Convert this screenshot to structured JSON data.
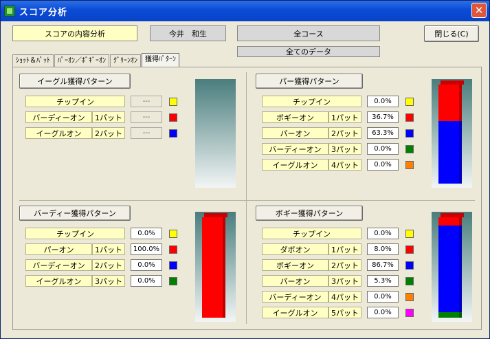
{
  "window": {
    "title": "スコア分析",
    "close": "✕"
  },
  "header": {
    "analysis_label": "スコアの内容分析",
    "player": "今井　和生",
    "course": "全コース",
    "data_scope": "全てのデータ",
    "close_button": "閉じる(C)"
  },
  "tabs": [
    "ｼｮｯﾄ＆ﾊﾟｯﾄ",
    "ﾊﾟｰｵﾝ／ﾎﾞｷﾞｰｵﾝ",
    "ｸﾞﾘｰﾝｵﾝ",
    "獲得ﾊﾟﾀｰﾝ"
  ],
  "colors": {
    "yellow": "#ffff00",
    "red": "#ff0000",
    "blue": "#0000ff",
    "green": "#008000",
    "orange": "#ff8000",
    "magenta": "#ff00ff"
  },
  "sections": {
    "eagle": {
      "title": "イーグル獲得パターン",
      "rows": [
        {
          "label": "チップイン",
          "putt": "",
          "value": "---",
          "color": "yellow"
        },
        {
          "label": "バーディーオン",
          "putt": "1パット",
          "value": "---",
          "color": "red"
        },
        {
          "label": "イーグルオン",
          "putt": "2パット",
          "value": "---",
          "color": "blue"
        }
      ]
    },
    "par": {
      "title": "パー獲得パターン",
      "rows": [
        {
          "label": "チップイン",
          "putt": "",
          "value": "0.0%",
          "color": "yellow"
        },
        {
          "label": "ボギーオン",
          "putt": "1パット",
          "value": "36.7%",
          "color": "red"
        },
        {
          "label": "パーオン",
          "putt": "2パット",
          "value": "63.3%",
          "color": "blue"
        },
        {
          "label": "バーディーオン",
          "putt": "3パット",
          "value": "0.0%",
          "color": "green"
        },
        {
          "label": "イーグルオン",
          "putt": "4パット",
          "value": "0.0%",
          "color": "orange"
        }
      ]
    },
    "birdie": {
      "title": "バーディー獲得パターン",
      "rows": [
        {
          "label": "チップイン",
          "putt": "",
          "value": "0.0%",
          "color": "yellow"
        },
        {
          "label": "パーオン",
          "putt": "1パット",
          "value": "100.0%",
          "color": "red"
        },
        {
          "label": "バーディーオン",
          "putt": "2パット",
          "value": "0.0%",
          "color": "blue"
        },
        {
          "label": "イーグルオン",
          "putt": "3パット",
          "value": "0.0%",
          "color": "green"
        }
      ]
    },
    "bogey": {
      "title": "ボギー獲得パターン",
      "rows": [
        {
          "label": "チップイン",
          "putt": "",
          "value": "0.0%",
          "color": "yellow"
        },
        {
          "label": "ダボオン",
          "putt": "1パット",
          "value": "8.0%",
          "color": "red"
        },
        {
          "label": "ボギーオン",
          "putt": "2パット",
          "value": "86.7%",
          "color": "blue"
        },
        {
          "label": "パーオン",
          "putt": "3パット",
          "value": "5.3%",
          "color": "green"
        },
        {
          "label": "バーディーオン",
          "putt": "4パット",
          "value": "0.0%",
          "color": "orange"
        },
        {
          "label": "イーグルオン",
          "putt": "5パット",
          "value": "0.0%",
          "color": "magenta"
        }
      ]
    }
  },
  "chart_data": [
    {
      "type": "bar",
      "stacked": true,
      "series": []
    },
    {
      "type": "bar",
      "stacked": true,
      "series": [
        {
          "name": "ボギーオン",
          "values": [
            36.7
          ],
          "color": "#ff0000"
        },
        {
          "name": "パーオン",
          "values": [
            63.3
          ],
          "color": "#0000ff"
        }
      ]
    },
    {
      "type": "bar",
      "stacked": true,
      "series": [
        {
          "name": "パーオン",
          "values": [
            100.0
          ],
          "color": "#ff0000"
        }
      ]
    },
    {
      "type": "bar",
      "stacked": true,
      "series": [
        {
          "name": "ダボオン",
          "values": [
            8.0
          ],
          "color": "#ff0000"
        },
        {
          "name": "ボギーオン",
          "values": [
            86.7
          ],
          "color": "#0000ff"
        },
        {
          "name": "パーオン",
          "values": [
            5.3
          ],
          "color": "#008000"
        }
      ]
    }
  ]
}
